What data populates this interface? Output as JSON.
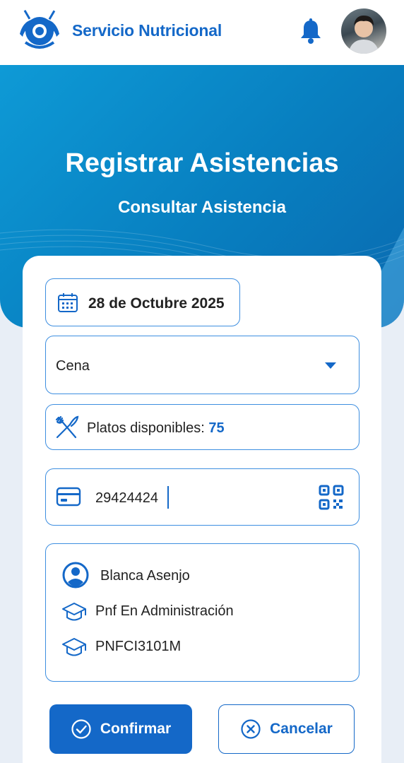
{
  "header": {
    "app_title": "Servicio Nutricional",
    "logo_icon": "utensils-plate-logo-icon",
    "bell_icon": "bell-icon",
    "avatar": "user-avatar"
  },
  "hero": {
    "title": "Registrar Asistencias",
    "subtitle": "Consultar Asistencia"
  },
  "form": {
    "date": {
      "icon": "calendar-icon",
      "value": "28 de Octubre 2025"
    },
    "meal_select": {
      "value": "Cena",
      "caret_icon": "caret-down-icon"
    },
    "plates": {
      "icon": "fork-knife-icon",
      "label": "Platos disponibles: ",
      "count": "75"
    },
    "id_input": {
      "icon": "credit-card-icon",
      "value": "29424424",
      "qr_icon": "qr-code-icon"
    },
    "student": {
      "name": "Blanca Asenjo",
      "program": "Pnf En Administración",
      "section": "PNFCI3101M",
      "name_icon": "user-circle-icon",
      "program_icon": "graduation-cap-icon",
      "section_icon": "graduation-cap-icon"
    }
  },
  "actions": {
    "confirm_label": "Confirmar",
    "confirm_icon": "check-circle-icon",
    "cancel_label": "Cancelar",
    "cancel_icon": "x-circle-icon"
  },
  "colors": {
    "primary": "#1468c8",
    "hero_start": "#0e9ad6",
    "hero_end": "#0a6ab0",
    "background": "#e8eef6"
  }
}
